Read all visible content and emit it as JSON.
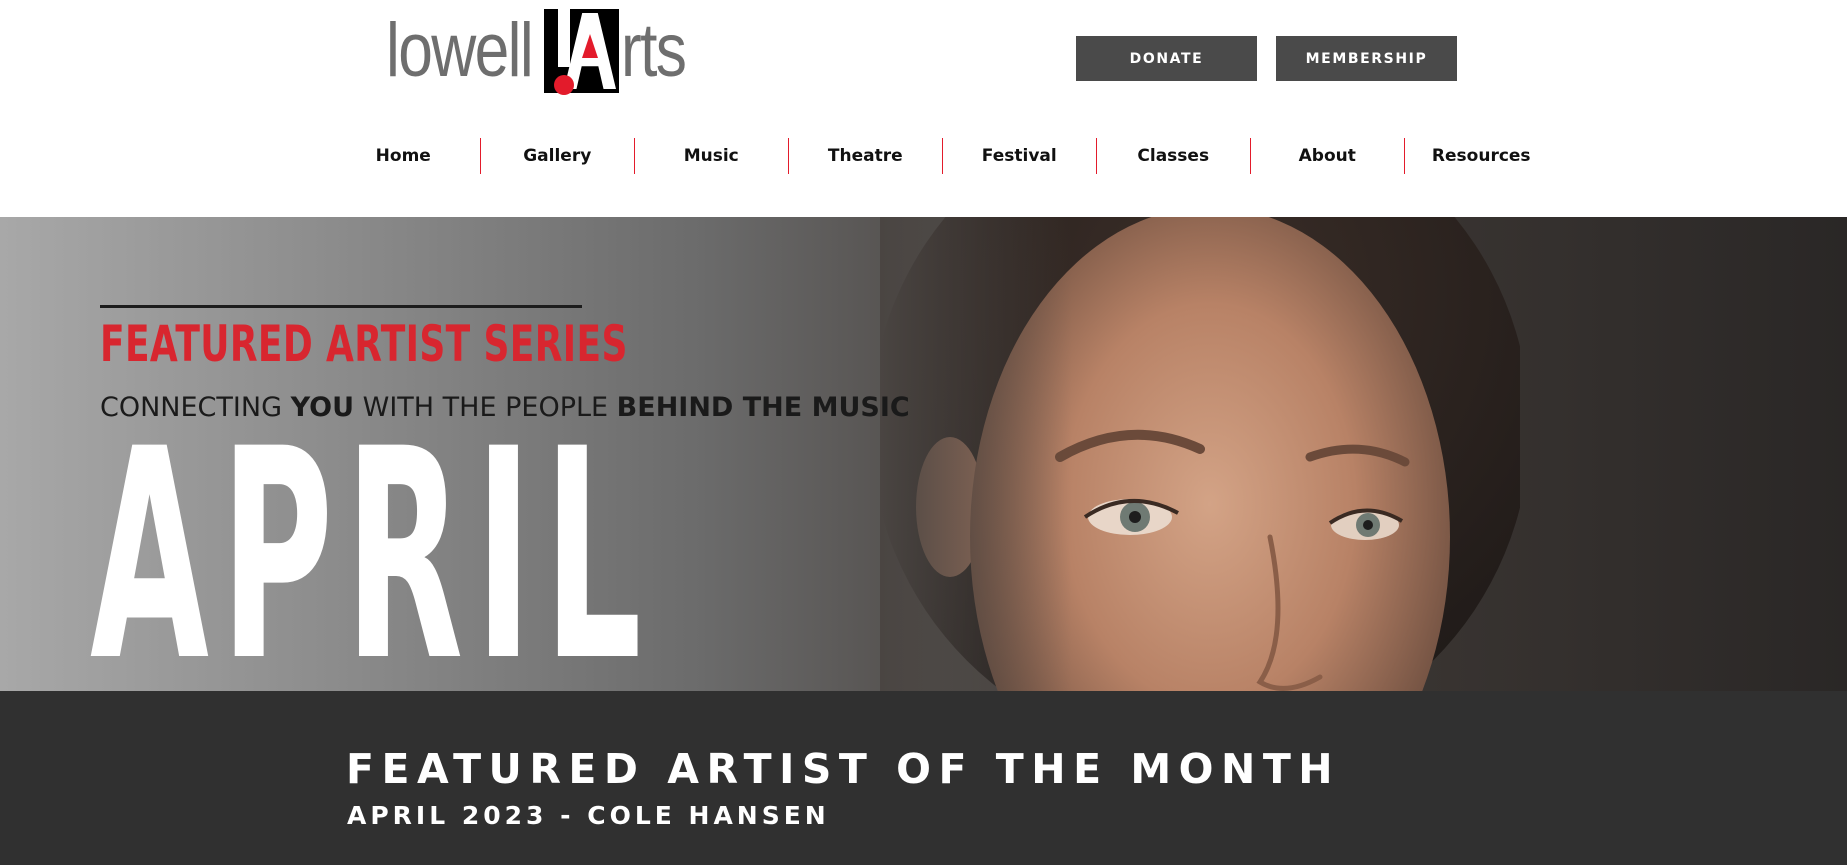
{
  "logo": {
    "left_text": "lowell",
    "right_text": "rts",
    "alt": "lowell!Arts"
  },
  "header": {
    "donate_label": "DONATE",
    "membership_label": "MEMBERSHIP"
  },
  "nav": {
    "items": [
      {
        "label": "Home"
      },
      {
        "label": "Gallery"
      },
      {
        "label": "Music"
      },
      {
        "label": "Theatre"
      },
      {
        "label": "Festival"
      },
      {
        "label": "Classes"
      },
      {
        "label": "About"
      },
      {
        "label": "Resources"
      }
    ]
  },
  "hero": {
    "series_title": "FEATURED ARTIST SERIES",
    "tagline_part1": "CONNECTING ",
    "tagline_bold1": "YOU",
    "tagline_part2": " WITH THE PEOPLE ",
    "tagline_bold2": "BEHIND THE MUSIC",
    "month": "APRIL"
  },
  "band": {
    "title": "FEATURED ARTIST OF THE MONTH",
    "subtitle": "APRIL 2023 - COLE HANSEN"
  },
  "colors": {
    "accent_red": "#e31b2b",
    "button_gray": "#4a4a4a",
    "band_dark": "#303030"
  }
}
